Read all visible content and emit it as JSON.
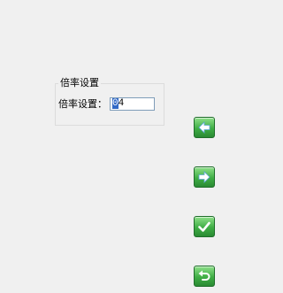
{
  "group": {
    "title": "倍率设置"
  },
  "field": {
    "label": "倍率设置：",
    "value_selected": "0",
    "value_rest": "4",
    "full_value": "04"
  },
  "side_buttons": [
    {
      "name": "back-button",
      "icon": "left-arrow-icon"
    },
    {
      "name": "next-button",
      "icon": "right-arrow-icon"
    },
    {
      "name": "confirm-button",
      "icon": "checkmark-icon"
    },
    {
      "name": "return-button",
      "icon": "undo-arrow-icon"
    }
  ],
  "colors": {
    "background": "#f0f0f0",
    "button_green": "#3fae45",
    "selection": "#3169c6"
  }
}
